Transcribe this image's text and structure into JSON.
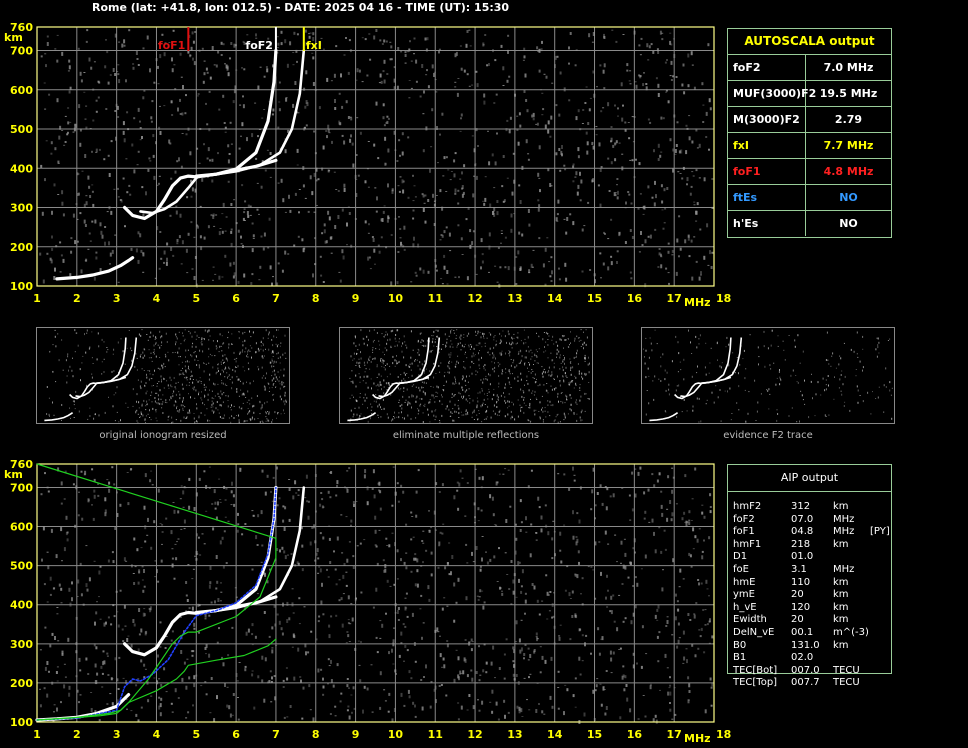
{
  "header": "Rome (lat: +41.8, lon: 012.5) - DATE: 2025 04 16 - TIME (UT): 15:30",
  "colors": {
    "frame": "#ffff88",
    "grid": "#8a8a8a",
    "trace": "#ffffff",
    "noise": "#9a9a9a",
    "fof1": "#e01010",
    "fxi": "#ffff00",
    "model_blue": "#2040ff",
    "profile_green": "#20d020",
    "table_border": "#99cc99",
    "label_blue": "#3399ff"
  },
  "autoscala": {
    "title": "AUTOSCALA output",
    "rows": [
      {
        "key": "foF2",
        "value": "7.0 MHz",
        "color": "#ffffff"
      },
      {
        "key": "MUF(3000)F2",
        "value": "19.5 MHz",
        "color": "#ffffff"
      },
      {
        "key": "M(3000)F2",
        "value": "2.79",
        "color": "#ffffff"
      },
      {
        "key": "fxI",
        "value": "7.7 MHz",
        "color": "#ffff00"
      },
      {
        "key": "foF1",
        "value": "4.8 MHz",
        "color": "#ff2020"
      },
      {
        "key": "ftEs",
        "value": "NO",
        "color": "#3399ff"
      },
      {
        "key": "h'Es",
        "value": "NO",
        "color": "#ffffff"
      }
    ]
  },
  "aip": {
    "title": "AIP output",
    "rows": [
      {
        "name": "hmF2",
        "value": "312",
        "unit": "km",
        "note": ""
      },
      {
        "name": "foF2",
        "value": "07.0",
        "unit": "MHz",
        "note": ""
      },
      {
        "name": "foF1",
        "value": "04.8",
        "unit": "MHz",
        "note": "[PY]"
      },
      {
        "name": "hmF1",
        "value": "218",
        "unit": "km",
        "note": ""
      },
      {
        "name": "D1",
        "value": "01.0",
        "unit": "",
        "note": ""
      },
      {
        "name": "foE",
        "value": "3.1",
        "unit": "MHz",
        "note": ""
      },
      {
        "name": "hmE",
        "value": "110",
        "unit": "km",
        "note": ""
      },
      {
        "name": "ymE",
        "value": "20",
        "unit": "km",
        "note": ""
      },
      {
        "name": "h_vE",
        "value": "120",
        "unit": "km",
        "note": ""
      },
      {
        "name": "Ewidth",
        "value": "20",
        "unit": "km",
        "note": ""
      },
      {
        "name": "DelN_vE",
        "value": "00.1",
        "unit": "m^(-3)",
        "note": ""
      },
      {
        "name": "B0",
        "value": "131.0",
        "unit": "km",
        "note": ""
      },
      {
        "name": "B1",
        "value": "02.0",
        "unit": "",
        "note": ""
      },
      {
        "name": "TEC[Bot]",
        "value": "007.0",
        "unit": "TECU",
        "note": ""
      },
      {
        "name": "TEC[Top]",
        "value": "007.7",
        "unit": "TECU",
        "note": ""
      }
    ]
  },
  "thumbnails": [
    {
      "caption": "original ionogram resized"
    },
    {
      "caption": "eliminate multiple reflections"
    },
    {
      "caption": "evidence F2 trace"
    }
  ],
  "chart_data": [
    {
      "type": "scatter",
      "title": "",
      "xlabel": "MHz",
      "ylabel": "km",
      "xlim": [
        1,
        18
      ],
      "ylim": [
        100,
        760
      ],
      "x_ticks": [
        1,
        2,
        3,
        4,
        5,
        6,
        7,
        8,
        9,
        10,
        11,
        12,
        13,
        14,
        15,
        16,
        17,
        18
      ],
      "y_ticks": [
        100,
        200,
        300,
        400,
        500,
        600,
        700,
        760
      ],
      "grid": true,
      "markers": [
        {
          "label": "foF1",
          "x": 4.8,
          "color": "#e01010"
        },
        {
          "label": "foF2",
          "x": 7.0,
          "color": "#ffffff"
        },
        {
          "label": "fxI",
          "x": 7.7,
          "color": "#ffff00"
        }
      ],
      "series": [
        {
          "role": "E trace",
          "x": [
            1.5,
            2.0,
            2.4,
            2.8,
            3.1,
            3.3,
            3.4
          ],
          "y": [
            118,
            122,
            128,
            138,
            152,
            165,
            172
          ]
        },
        {
          "role": "F1 trace O",
          "x": [
            3.2,
            3.4,
            3.7,
            4.0,
            4.2,
            4.4,
            4.6,
            4.8,
            5.0,
            5.5,
            6.0,
            6.5,
            7.0
          ],
          "y": [
            300,
            280,
            272,
            290,
            320,
            355,
            375,
            380,
            378,
            385,
            395,
            405,
            420
          ]
        },
        {
          "role": "F2 trace O",
          "x": [
            5.0,
            5.5,
            6.0,
            6.5,
            6.8,
            6.95,
            7.0
          ],
          "y": [
            380,
            385,
            398,
            440,
            520,
            620,
            700
          ]
        },
        {
          "role": "F1 trace X",
          "x": [
            3.6,
            3.9,
            4.2,
            4.5,
            4.8,
            5.0
          ],
          "y": [
            290,
            286,
            296,
            315,
            350,
            375
          ]
        },
        {
          "role": "F2 trace X",
          "x": [
            5.2,
            6.0,
            6.6,
            7.1,
            7.4,
            7.6,
            7.7
          ],
          "y": [
            380,
            392,
            408,
            440,
            500,
            590,
            700
          ]
        }
      ]
    },
    {
      "type": "scatter",
      "title": "",
      "xlabel": "MHz",
      "ylabel": "km",
      "xlim": [
        1,
        18
      ],
      "ylim": [
        100,
        760
      ],
      "x_ticks": [
        1,
        2,
        3,
        4,
        5,
        6,
        7,
        8,
        9,
        10,
        11,
        12,
        13,
        14,
        15,
        16,
        17,
        18
      ],
      "y_ticks": [
        100,
        200,
        300,
        400,
        500,
        600,
        700,
        760
      ],
      "grid": true,
      "series": [
        {
          "role": "E trace",
          "x": [
            1.0,
            1.5,
            2.0,
            2.5,
            3.0,
            3.3
          ],
          "y": [
            105,
            108,
            112,
            122,
            140,
            170
          ]
        },
        {
          "role": "F1 trace O",
          "x": [
            3.2,
            3.4,
            3.7,
            4.0,
            4.2,
            4.4,
            4.6,
            4.8,
            5.0,
            5.5,
            6.0,
            6.5,
            7.0
          ],
          "y": [
            300,
            280,
            272,
            290,
            320,
            355,
            375,
            380,
            378,
            385,
            395,
            405,
            420
          ]
        },
        {
          "role": "F2 trace O",
          "x": [
            5.0,
            5.5,
            6.0,
            6.5,
            6.8,
            6.95,
            7.0
          ],
          "y": [
            380,
            385,
            398,
            440,
            520,
            620,
            700
          ]
        },
        {
          "role": "F2 trace X",
          "x": [
            5.2,
            6.0,
            6.6,
            7.1,
            7.4,
            7.6,
            7.7
          ],
          "y": [
            380,
            392,
            408,
            440,
            500,
            590,
            700
          ]
        },
        {
          "role": "model virtual height",
          "x": [
            1.0,
            2.0,
            3.0,
            3.2,
            3.4,
            3.6,
            3.9,
            4.3,
            4.7,
            5.0,
            5.5,
            6.0,
            6.5,
            6.8,
            6.95,
            7.0
          ],
          "y": [
            105,
            110,
            130,
            190,
            210,
            205,
            222,
            260,
            330,
            372,
            385,
            405,
            450,
            530,
            620,
            700
          ]
        },
        {
          "role": "electron density profile",
          "x": [
            1.0,
            7.0,
            7.0,
            6.6,
            6.0,
            5.0,
            4.8,
            4.6,
            4.4,
            3.8,
            3.3,
            3.1,
            2.8,
            2.0,
            1.0
          ],
          "y": [
            760,
            570,
            520,
            420,
            370,
            330,
            330,
            320,
            300,
            210,
            150,
            130,
            122,
            112,
            105
          ]
        },
        {
          "role": "electron density profile lower",
          "x": [
            1.0,
            1.8,
            2.6,
            3.0,
            3.1,
            3.3,
            4.0,
            4.5,
            4.7,
            4.8,
            5.5,
            6.2,
            6.8,
            7.0
          ],
          "y": [
            105,
            110,
            116,
            122,
            130,
            150,
            180,
            210,
            230,
            245,
            258,
            270,
            295,
            312
          ]
        }
      ]
    }
  ]
}
